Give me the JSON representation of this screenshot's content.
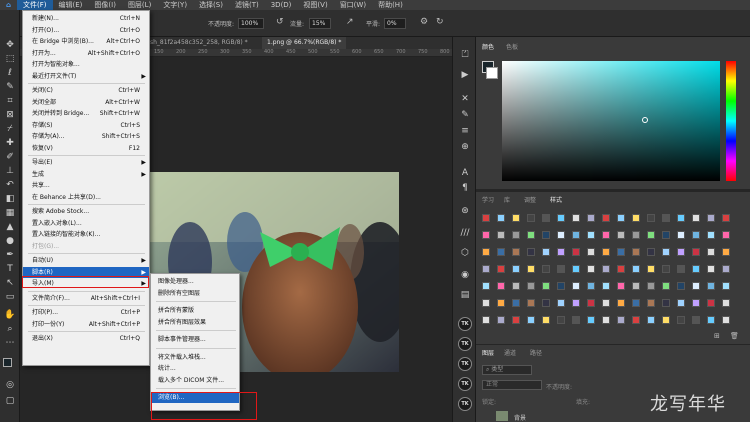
{
  "menubar": {
    "items": [
      "文件(F)",
      "编辑(E)",
      "图像(I)",
      "图层(L)",
      "文字(Y)",
      "选择(S)",
      "滤镜(T)",
      "3D(D)",
      "视图(V)",
      "窗口(W)",
      "帮助(H)"
    ],
    "active_index": 0
  },
  "options": {
    "opacity_label": "不透明度:",
    "opacity_value": "100%",
    "flow_label": "流量:",
    "flow_value": "15%",
    "smooth_label": "平滑:",
    "smooth_value": "0%"
  },
  "tabs": [
    {
      "label": "sh_81f2a458c352_258, RGB/8) *",
      "active": false
    },
    {
      "label": "1.png @ 66.7%(RGB/8) *",
      "active": true
    }
  ],
  "ruler_ticks": [
    "150",
    "200",
    "250",
    "300",
    "350",
    "400",
    "450",
    "500",
    "550",
    "600",
    "650",
    "700",
    "750",
    "800"
  ],
  "file_menu": [
    {
      "label": "新建(N)...",
      "shortcut": "Ctrl+N"
    },
    {
      "label": "打开(O)...",
      "shortcut": "Ctrl+O"
    },
    {
      "label": "在 Bridge 中浏览(B)...",
      "shortcut": "Alt+Ctrl+O"
    },
    {
      "label": "打开为...",
      "shortcut": "Alt+Shift+Ctrl+O"
    },
    {
      "label": "打开为智能对象...",
      "shortcut": ""
    },
    {
      "label": "最近打开文件(T)",
      "shortcut": "",
      "submenu": true
    },
    {
      "sep": true
    },
    {
      "label": "关闭(C)",
      "shortcut": "Ctrl+W"
    },
    {
      "label": "关闭全部",
      "shortcut": "Alt+Ctrl+W"
    },
    {
      "label": "关闭并转到 Bridge...",
      "shortcut": "Shift+Ctrl+W"
    },
    {
      "label": "存储(S)",
      "shortcut": "Ctrl+S"
    },
    {
      "label": "存储为(A)...",
      "shortcut": "Shift+Ctrl+S"
    },
    {
      "label": "恢复(V)",
      "shortcut": "F12"
    },
    {
      "sep": true
    },
    {
      "label": "导出(E)",
      "shortcut": "",
      "submenu": true
    },
    {
      "label": "生成",
      "shortcut": "",
      "submenu": true
    },
    {
      "label": "共享...",
      "shortcut": ""
    },
    {
      "label": "在 Behance 上共享(D)...",
      "shortcut": ""
    },
    {
      "sep": true
    },
    {
      "label": "搜索 Adobe Stock...",
      "shortcut": ""
    },
    {
      "label": "置入嵌入对象(L)...",
      "shortcut": ""
    },
    {
      "label": "置入链接的智能对象(K)...",
      "shortcut": ""
    },
    {
      "label": "打包(G)...",
      "shortcut": "",
      "disabled": true
    },
    {
      "sep": true
    },
    {
      "label": "自动(U)",
      "shortcut": "",
      "submenu": true
    },
    {
      "label": "脚本(R)",
      "shortcut": "",
      "submenu": true,
      "highlighted": true
    },
    {
      "label": "导入(M)",
      "shortcut": "",
      "submenu": true
    },
    {
      "sep": true
    },
    {
      "label": "文件简介(F)...",
      "shortcut": "Alt+Shift+Ctrl+I"
    },
    {
      "sep": true
    },
    {
      "label": "打印(P)...",
      "shortcut": "Ctrl+P"
    },
    {
      "label": "打印一份(Y)",
      "shortcut": "Alt+Shift+Ctrl+P"
    },
    {
      "sep": true
    },
    {
      "label": "退出(X)",
      "shortcut": "Ctrl+Q"
    }
  ],
  "scripts_menu": [
    {
      "label": "图像处理器..."
    },
    {
      "label": "删除所有空图层"
    },
    {
      "sep": true
    },
    {
      "label": "拼合所有蒙版"
    },
    {
      "label": "拼合所有图层效果"
    },
    {
      "sep": true
    },
    {
      "label": "脚本事件管理器..."
    },
    {
      "sep": true
    },
    {
      "label": "将文件载入堆栈..."
    },
    {
      "label": "统计..."
    },
    {
      "label": "载入多个 DICOM 文件..."
    },
    {
      "sep": true
    },
    {
      "label": "浏览(B)...",
      "highlighted": true
    }
  ],
  "panels": {
    "color_tabs": [
      "颜色",
      "色板"
    ],
    "style_tabs": [
      "学习",
      "库",
      "调整",
      "样式"
    ],
    "layer_tabs": [
      "图层",
      "通道",
      "路径"
    ],
    "layer_search": "类型",
    "layer_mode": "正常",
    "layer_opacity_label": "不透明度:",
    "lock_label": "锁定:",
    "fill_label": "填充:",
    "layer_name": "背景"
  },
  "theme": {
    "accent": "#1f66c2",
    "highlight_box": "#e01818",
    "hue_color": "#00dde8"
  },
  "watermark": "龙写年华"
}
